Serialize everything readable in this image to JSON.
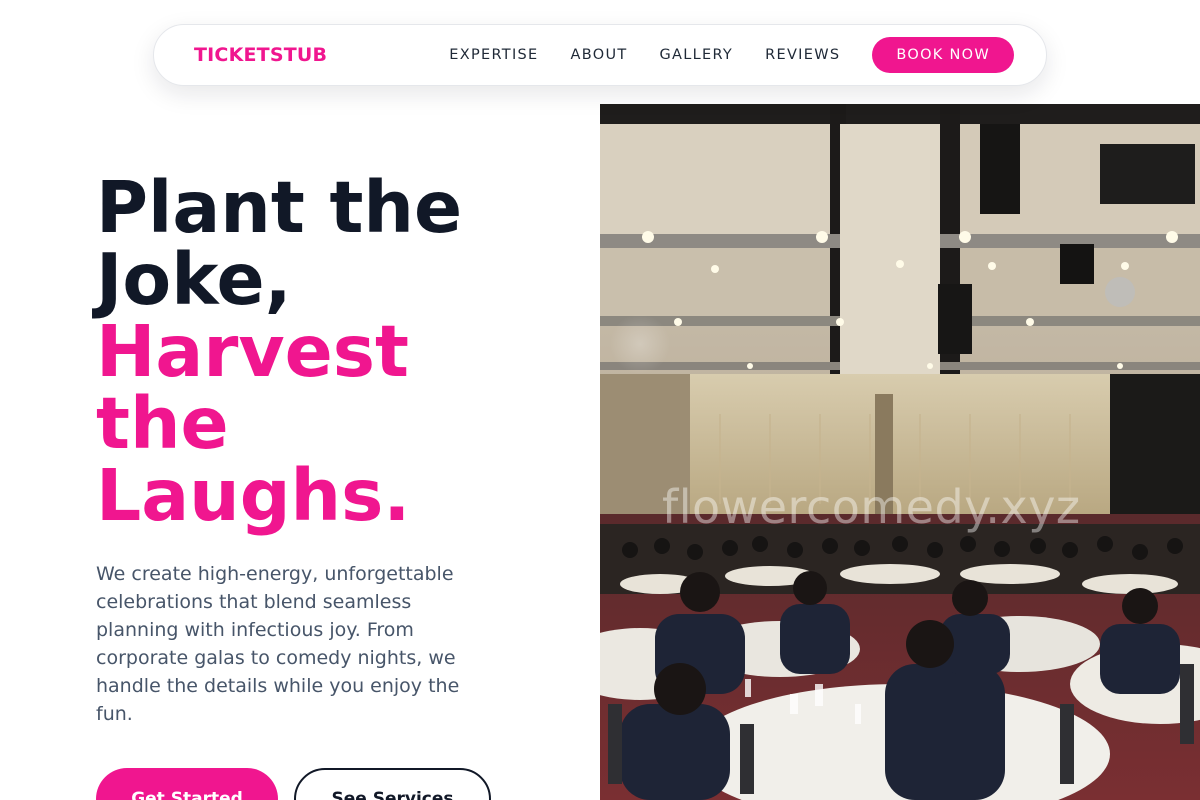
{
  "nav": {
    "brand": "TICKETSTUB",
    "links": [
      "EXPERTISE",
      "ABOUT",
      "GALLERY",
      "REVIEWS"
    ],
    "cta": "BOOK NOW"
  },
  "hero": {
    "title_line1": "Plant the",
    "title_line2": "Joke,",
    "title_accent_line1": "Harvest",
    "title_accent_line2": "the",
    "title_accent_line3": "Laughs.",
    "subtitle": "We create high-energy, unforgettable celebrations that blend seamless planning with infectious joy. From corporate galas to comedy nights, we handle the details while you enjoy the fun.",
    "primary_button": "Get Started",
    "secondary_button": "See Services",
    "image_watermark": "flowercomedy.xyz"
  },
  "colors": {
    "accent": "#f0168f",
    "heading": "#111827",
    "body_text": "#475569"
  }
}
